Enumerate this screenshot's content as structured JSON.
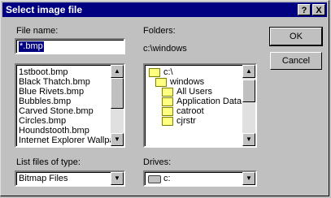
{
  "window": {
    "title": "Select image file",
    "help_label": "?",
    "close_label": "X"
  },
  "file_name": {
    "label": "File name:",
    "value": "*.bmp"
  },
  "file_list": [
    "1stboot.bmp",
    "Black Thatch.bmp",
    "Blue Rivets.bmp",
    "Bubbles.bmp",
    "Carved Stone.bmp",
    "Circles.bmp",
    "Houndstooth.bmp",
    "Internet Explorer Wallpa"
  ],
  "folders": {
    "label": "Folders:",
    "current_path": "c:\\windows",
    "items": [
      "c:\\",
      "windows",
      "All Users",
      "Application Data",
      "catroot",
      "cjrstr"
    ]
  },
  "buttons": {
    "ok": "OK",
    "cancel": "Cancel"
  },
  "file_type": {
    "label": "List files of type:",
    "value": "Bitmap Files"
  },
  "drives": {
    "label": "Drives:",
    "value": "c:"
  }
}
